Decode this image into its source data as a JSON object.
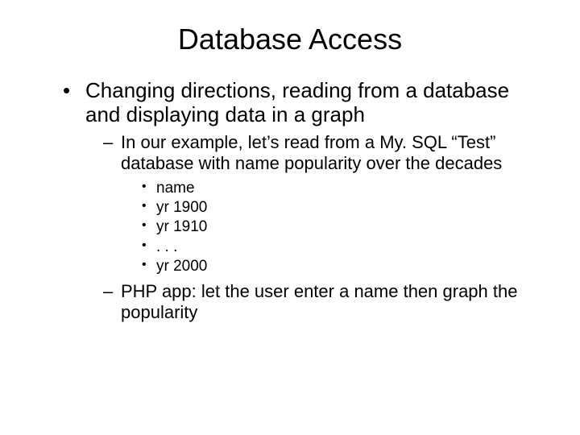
{
  "title": "Database Access",
  "bullets": {
    "main": "Changing directions, reading from a database and displaying data in a graph",
    "sub1": "In our example, let’s read from a My. SQL “Test” database with name popularity over the decades",
    "fields": {
      "f0": "name",
      "f1": "yr 1900",
      "f2": "yr 1910",
      "f3": ". . .",
      "f4": "yr 2000"
    },
    "sub2": "PHP app:  let the user enter a name then graph the popularity"
  }
}
